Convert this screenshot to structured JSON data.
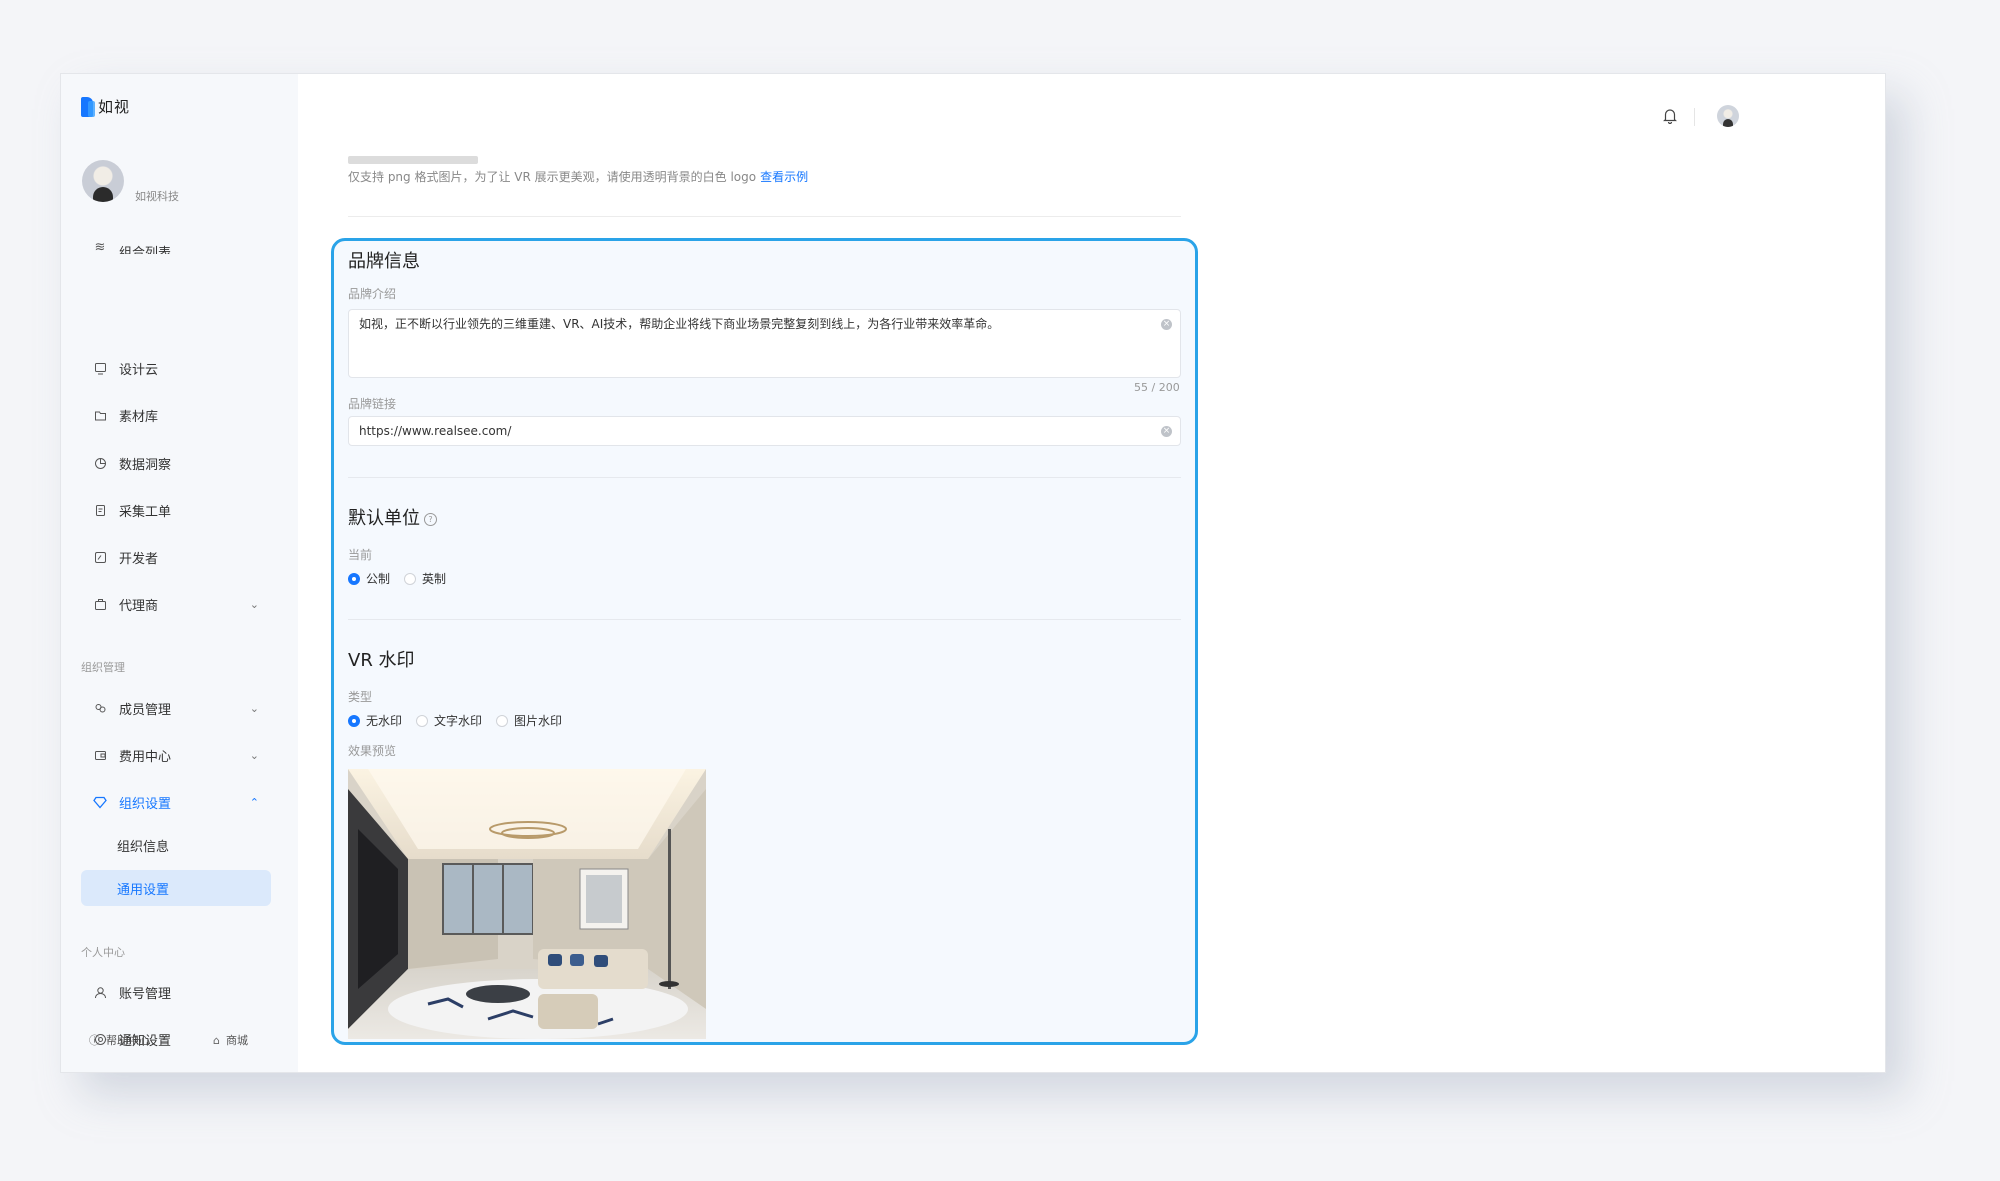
{
  "app": {
    "brand": "如视"
  },
  "sidebar": {
    "org_name": "如视科技",
    "items": [
      {
        "label": "组合列表",
        "icon": "layers-icon"
      },
      {
        "label": "设计云",
        "icon": "monitor-icon"
      },
      {
        "label": "素材库",
        "icon": "folder-icon"
      },
      {
        "label": "数据洞察",
        "icon": "pie-chart-icon"
      },
      {
        "label": "采集工单",
        "icon": "clipboard-icon"
      },
      {
        "label": "开发者",
        "icon": "code-icon"
      },
      {
        "label": "代理商",
        "icon": "briefcase-icon",
        "expandable": true
      }
    ],
    "org_section": "组织管理",
    "org_items": [
      {
        "label": "成员管理",
        "icon": "members-icon",
        "expandable": true
      },
      {
        "label": "费用中心",
        "icon": "wallet-icon",
        "expandable": true
      },
      {
        "label": "组织设置",
        "icon": "diamond-icon",
        "expanded": true,
        "active": true
      }
    ],
    "org_sub_items": [
      {
        "label": "组织信息"
      },
      {
        "label": "通用设置",
        "selected": true
      }
    ],
    "personal_section": "个人中心",
    "personal_items": [
      {
        "label": "账号管理",
        "icon": "user-icon"
      },
      {
        "label": "通知设置",
        "icon": "settings-icon"
      }
    ],
    "footer": {
      "help": "帮助中心",
      "store": "商城"
    }
  },
  "main": {
    "logo_note": "仅支持 png 格式图片，为了让 VR 展示更美观，请使用透明背景的白色 logo",
    "logo_note_link": "查看示例",
    "brand_info": {
      "title": "品牌信息",
      "intro_label": "品牌介绍",
      "intro_value": "如视，正不断以行业领先的三维重建、VR、AI技术，帮助企业将线下商业场景完整复刻到线上，为各行业带来效率革命。",
      "counter": "55 / 200",
      "link_label": "品牌链接",
      "link_value": "https://www.realsee.com/"
    },
    "default_unit": {
      "title": "默认单位",
      "current_label": "当前",
      "options": [
        "公制",
        "英制"
      ],
      "selected": "公制"
    },
    "watermark": {
      "title": "VR 水印",
      "type_label": "类型",
      "options": [
        "无水印",
        "文字水印",
        "图片水印"
      ],
      "selected": "无水印",
      "preview_label": "效果预览"
    }
  }
}
